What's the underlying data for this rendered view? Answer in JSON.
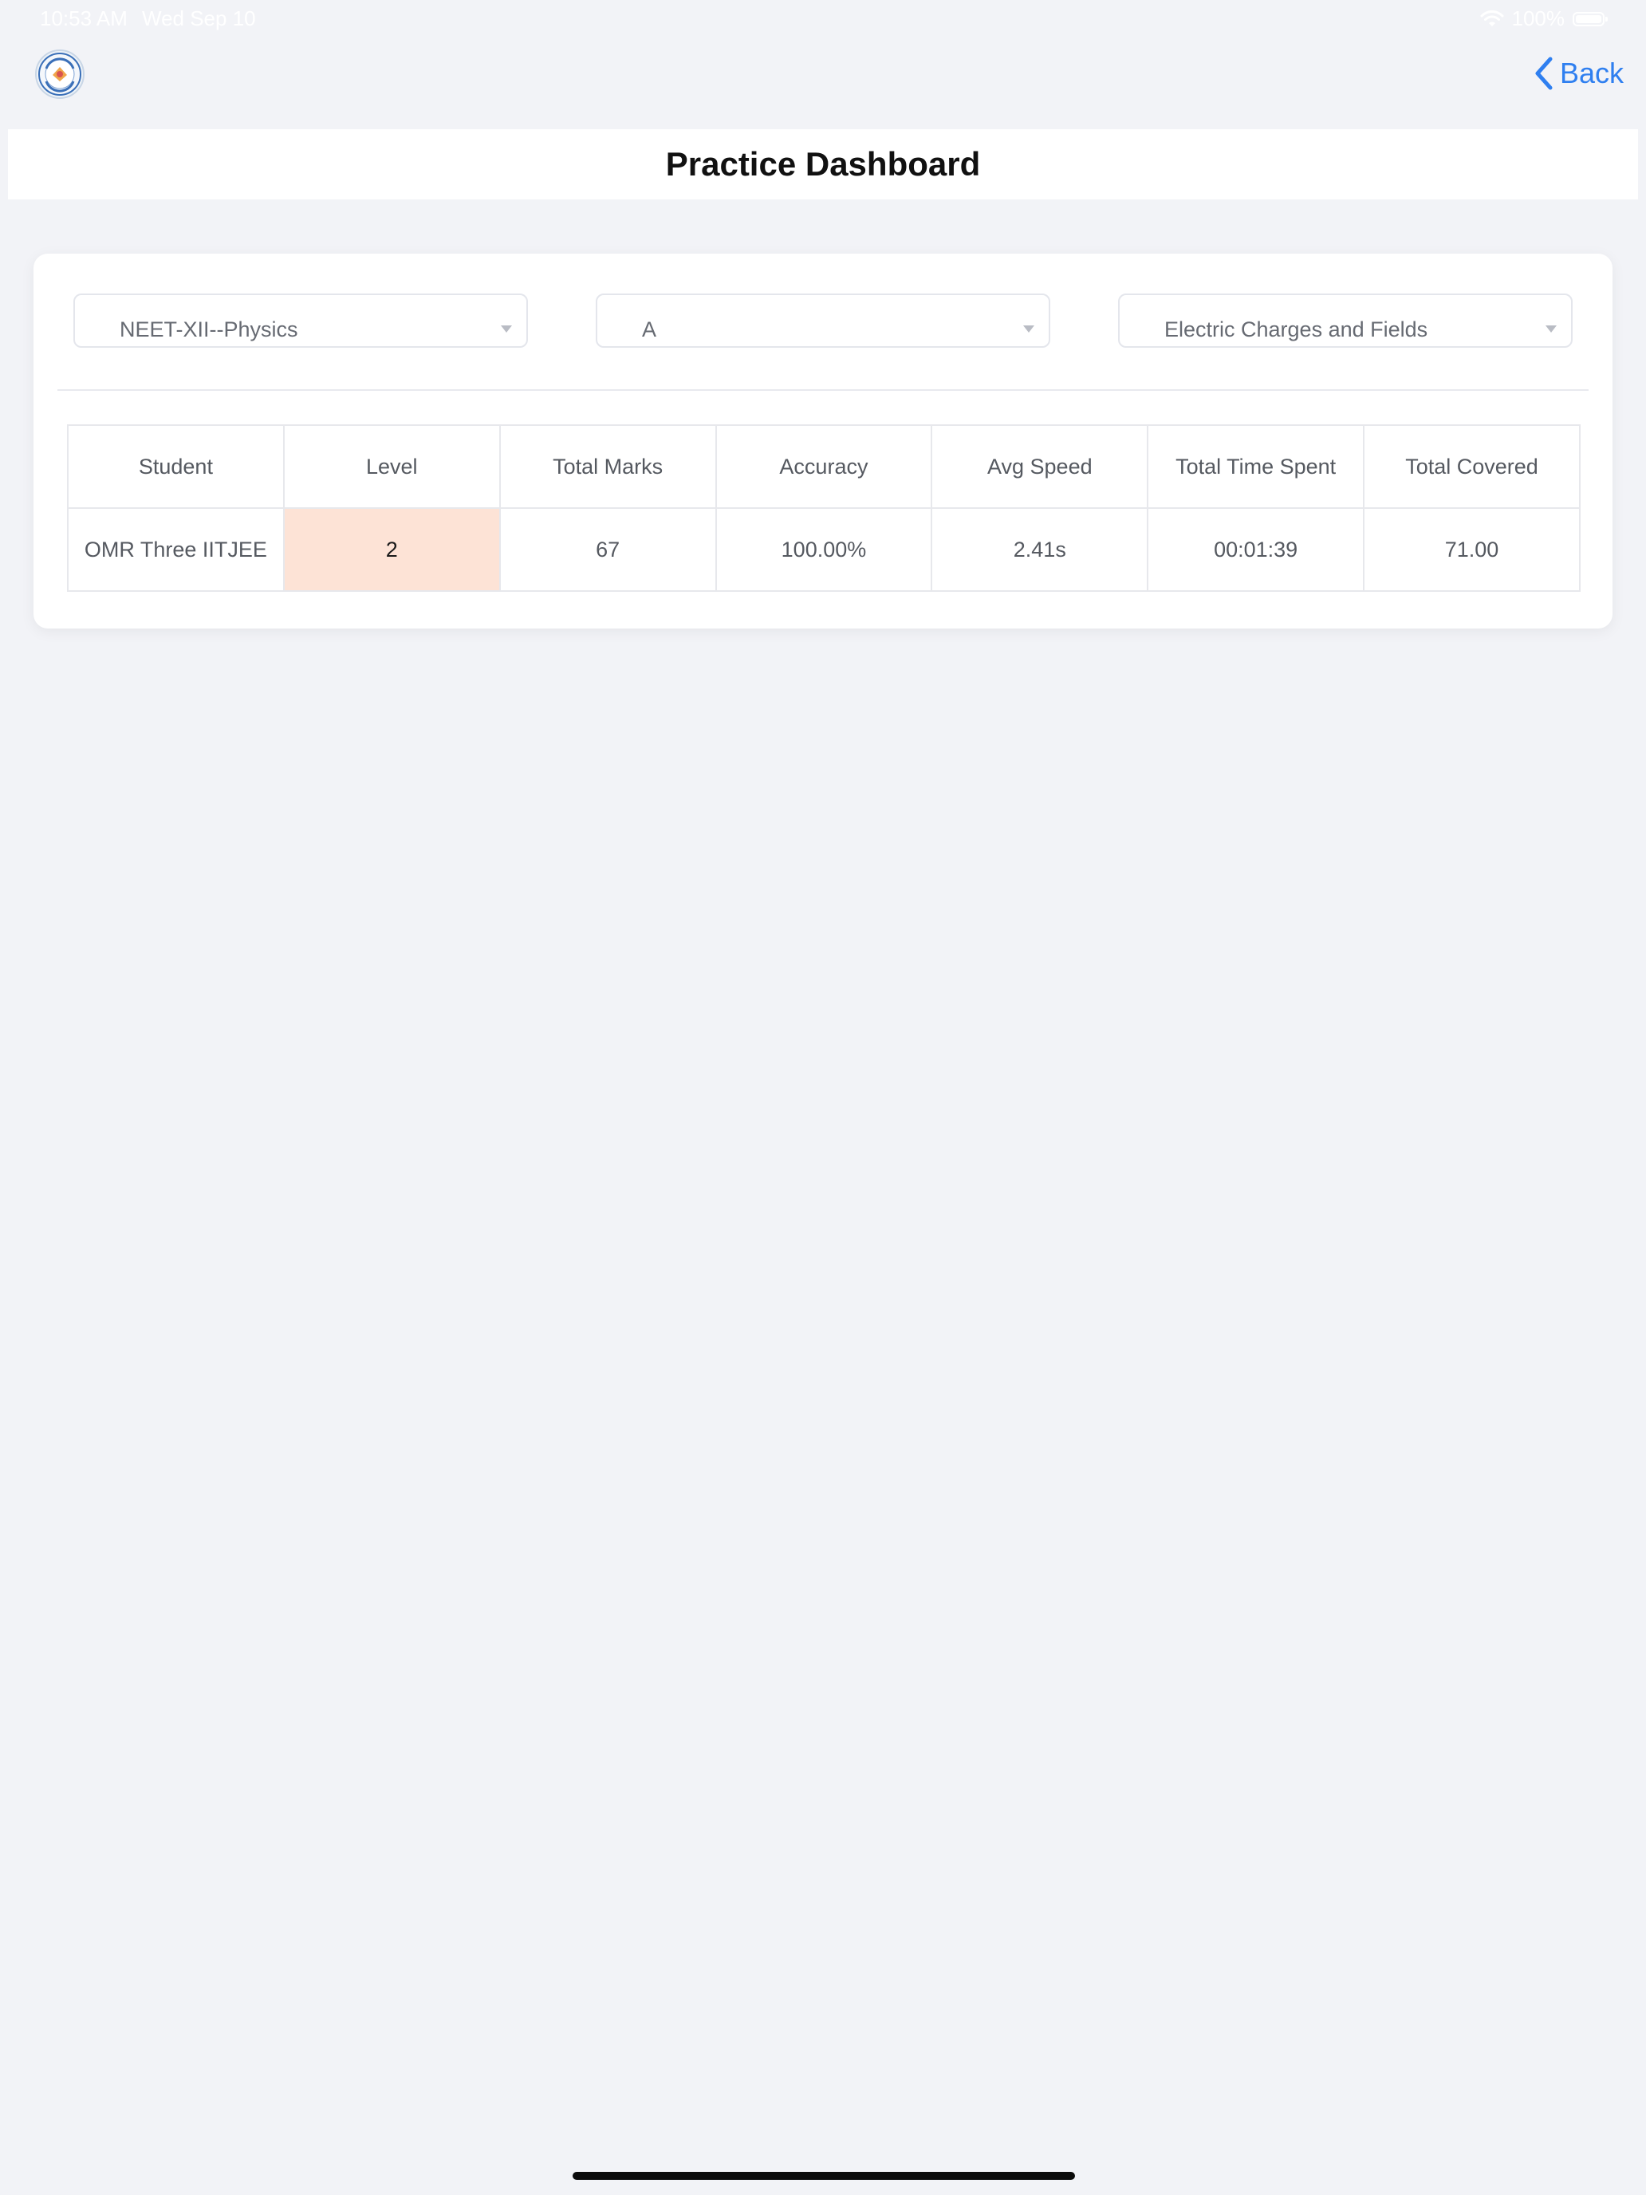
{
  "status_bar": {
    "time": "10:53 AM",
    "date": "Wed Sep 10",
    "battery_percent": "100%"
  },
  "nav": {
    "back_label": "Back"
  },
  "header": {
    "title": "Practice Dashboard"
  },
  "filters": {
    "course": "NEET-XII--Physics",
    "section": "A",
    "chapter": "Electric Charges and Fields"
  },
  "table": {
    "headers": [
      "Student",
      "Level",
      "Total Marks",
      "Accuracy",
      "Avg Speed",
      "Total Time Spent",
      "Total Covered"
    ],
    "rows": [
      {
        "student": "OMR Three IITJEE",
        "level": "2",
        "total_marks": "67",
        "accuracy": "100.00%",
        "avg_speed": "2.41s",
        "total_time_spent": "00:01:39",
        "total_covered": "71.00"
      }
    ]
  },
  "colors": {
    "accent": "#2f7ff0",
    "level_highlight": "#fde3d6",
    "background": "#f2f3f7"
  },
  "icons": {
    "logo": "school-logo",
    "back": "chevron-left-icon",
    "wifi": "wifi-icon",
    "battery": "battery-icon",
    "dropdown": "caret-down-icon"
  }
}
